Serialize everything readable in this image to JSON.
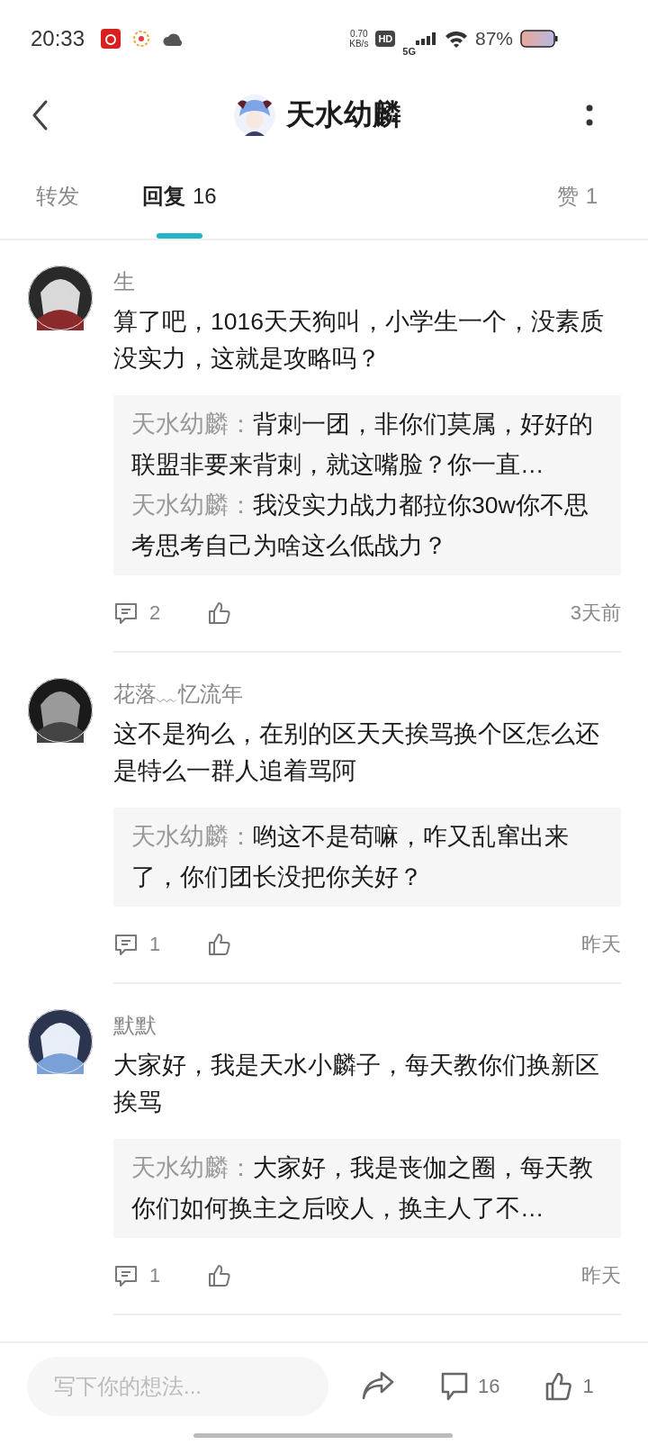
{
  "status_bar": {
    "time": "20:33",
    "speed_value": "0.70",
    "speed_unit": "KB/s",
    "hd": "HD",
    "network": "5G",
    "battery_percent": "87%"
  },
  "header": {
    "title": "天水幼麟"
  },
  "tabs": [
    {
      "label": "转发",
      "selected": false
    },
    {
      "label": "回复",
      "count": "16",
      "selected": true
    },
    {
      "label": "赞",
      "count": "1",
      "selected": false
    }
  ],
  "comments": [
    {
      "author": "生",
      "text": "算了吧，1016天天狗叫，小学生一个，没素质没实力，这就是攻略吗？",
      "quotes": [
        {
          "author": "天水幼麟：",
          "text": "背刺一团，非你们莫属，好好的联盟非要来背刺，就这嘴脸？你一直…"
        },
        {
          "author": "天水幼麟：",
          "text": "我没实力战力都拉你30w你不思考思考自己为啥这么低战力？"
        }
      ],
      "replies": "2",
      "time": "3天前"
    },
    {
      "author": "花落﹏忆流年",
      "text": "这不是狗么，在别的区天天挨骂换个区怎么还是特么一群人追着骂阿",
      "quotes": [
        {
          "author": "天水幼麟：",
          "text": "哟这不是苟嘛，咋又乱窜出来了，你们团长没把你关好？"
        }
      ],
      "replies": "1",
      "time": "昨天"
    },
    {
      "author": "默默",
      "text": "大家好，我是天水小麟子，每天教你们换新区挨骂",
      "quotes": [
        {
          "author": "天水幼麟：",
          "text": "大家好，我是丧伽之圈，每天教你们如何换主之后咬人，换主人了不…"
        }
      ],
      "replies": "1",
      "time": "昨天"
    }
  ],
  "bottom_bar": {
    "placeholder": "写下你的想法...",
    "comment_count": "16",
    "like_count": "1"
  }
}
